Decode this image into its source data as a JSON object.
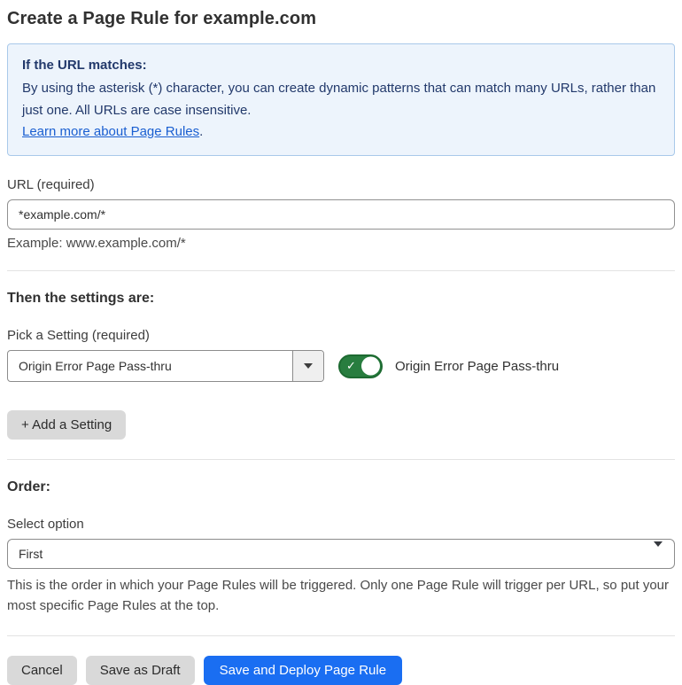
{
  "page": {
    "title": "Create a Page Rule for example.com"
  },
  "info_box": {
    "heading": "If the URL matches:",
    "body": "By using the asterisk (*) character, you can create dynamic patterns that can match many URLs, rather than just one. All URLs are case insensitive.",
    "link_text": "Learn more about Page Rules",
    "link_suffix": "."
  },
  "url_field": {
    "label": "URL (required)",
    "value": "*example.com/*",
    "example": "Example: www.example.com/*"
  },
  "settings_section": {
    "heading": "Then the settings are:",
    "picker_label": "Pick a Setting (required)",
    "picker_value": "Origin Error Page Pass-thru",
    "toggle_label": "Origin Error Page Pass-thru",
    "toggle_state": "on",
    "toggle_check_glyph": "✓",
    "add_button_label": "+ Add a Setting"
  },
  "order_section": {
    "heading": "Order:",
    "select_label": "Select option",
    "select_value": "First",
    "help_text": "This is the order in which your Page Rules will be triggered. Only one Page Rule will trigger per URL, so put your most specific Page Rules at the top."
  },
  "actions": {
    "cancel_label": "Cancel",
    "save_draft_label": "Save as Draft",
    "save_deploy_label": "Save and Deploy Page Rule"
  },
  "colors": {
    "info_box_bg": "#edf4fc",
    "info_box_border": "#a9c9ea",
    "info_text": "#22396b",
    "link_blue": "#1a5fd1",
    "toggle_green": "#287d3f",
    "primary_button_blue": "#1a6ef2",
    "gray_button_bg": "#d9d9d9",
    "divider_gray": "#e3e3e3"
  }
}
